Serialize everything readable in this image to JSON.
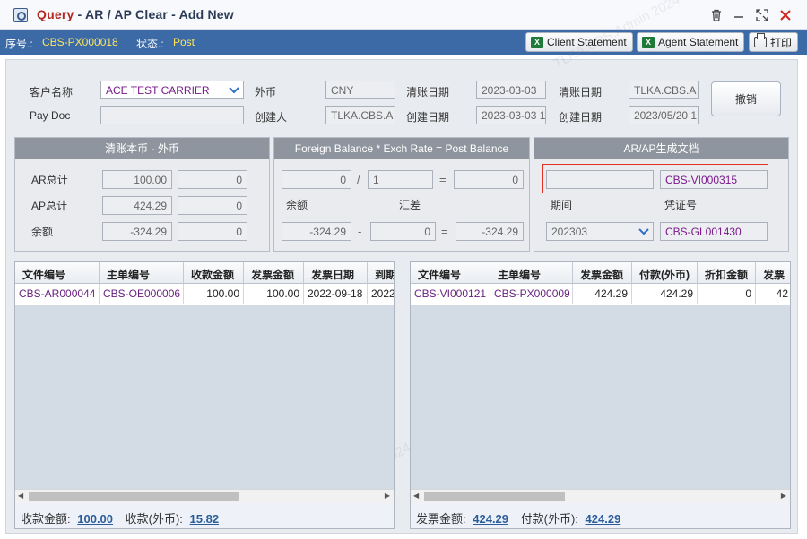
{
  "window": {
    "title_prefix": "Query",
    "title_rest": " - AR / AP Clear - Add New"
  },
  "header": {
    "seq_label": "序号.:",
    "seq_value": "CBS-PX000018",
    "status_label": "状态.:",
    "status_value": "Post",
    "client_statement": "Client Statement",
    "agent_statement": "Agent Statement",
    "print": "打印"
  },
  "form": {
    "customer_label": "客户名称",
    "customer_value": "ACE TEST CARRIER",
    "paydoc_label": "Pay Doc",
    "paydoc_value": "",
    "currency_label": "外币",
    "currency_value": "CNY",
    "creator_label": "创建人",
    "creator_value": "TLKA.CBS.A",
    "clear_date_label": "清账日期",
    "clear_date_value": "2023-03-03",
    "create_date_label": "创建日期",
    "create_date_value": "2023-03-03 1",
    "clear_date2_label": "清账日期",
    "clear_date2_value": "TLKA.CBS.A",
    "create_date2_label": "创建日期",
    "create_date2_value": "2023/05/20 1",
    "cancel_button": "撤销"
  },
  "section_local": {
    "title": "清账本币 - 外币",
    "ar_label": "AR总计",
    "ar_local": "100.00",
    "ar_foreign": "0",
    "ap_label": "AP总计",
    "ap_local": "424.29",
    "ap_foreign": "0",
    "bal_label": "余额",
    "bal_local": "-324.29",
    "bal_foreign": "0"
  },
  "section_foreign": {
    "title": "Foreign Balance * Exch Rate = Post Balance",
    "foreign_balance": "0",
    "slash": "/",
    "rate": "1",
    "eq1": "=",
    "post_balance": "0",
    "balance_label": "余额",
    "diff_label": "汇差",
    "balance_value": "-324.29",
    "minus": "-",
    "diff_value": "0",
    "eq2": "=",
    "result_value": "-324.29"
  },
  "section_doc": {
    "title": "AR/AP生成文档",
    "doc_blank": "",
    "doc_no": "CBS-VI000315",
    "period_label": "期间",
    "voucher_label": "凭证号",
    "period_value": "202303",
    "voucher_value": "CBS-GL001430"
  },
  "ar_grid": {
    "columns": [
      "文件编号",
      "主单编号",
      "收款金额",
      "发票金额",
      "发票日期",
      "到期"
    ],
    "row": [
      "CBS-AR000044",
      "CBS-OE000006",
      "100.00",
      "100.00",
      "2022-09-18",
      "2022"
    ],
    "footer_label1": "收款金额:",
    "footer_value1": "100.00",
    "footer_label2": "收款(外币):",
    "footer_value2": "15.82"
  },
  "ap_grid": {
    "columns": [
      "文件编号",
      "主单编号",
      "发票金额",
      "付款(外币)",
      "折扣金额",
      "发票"
    ],
    "row": [
      "CBS-VI000121",
      "CBS-PX000009",
      "424.29",
      "424.29",
      "0",
      "42"
    ],
    "footer_label1": "发票金额:",
    "footer_value1": "424.29",
    "footer_label2": "付款(外币):",
    "footer_value2": "424.29"
  }
}
